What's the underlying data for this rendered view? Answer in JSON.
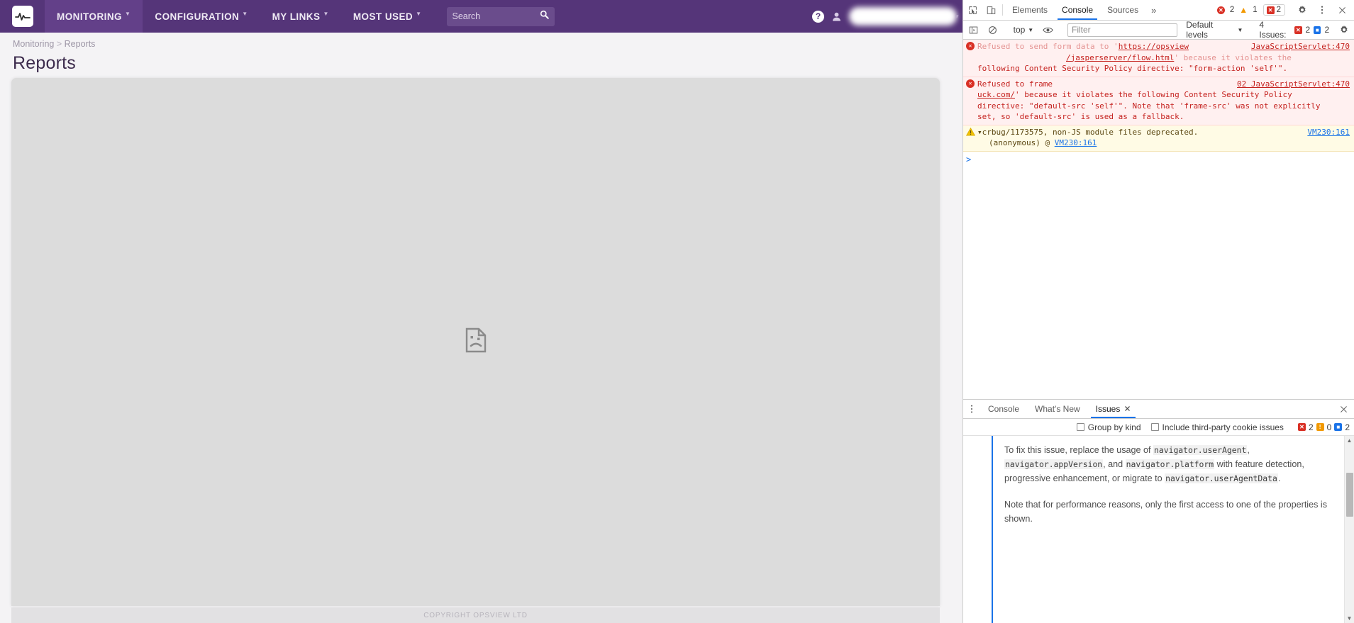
{
  "app": {
    "nav": {
      "logo_name": "opsview-logo",
      "items": [
        {
          "label": "MONITORING",
          "active": true,
          "caret": true
        },
        {
          "label": "CONFIGURATION",
          "active": false,
          "caret": true
        },
        {
          "label": "MY LINKS",
          "active": false,
          "caret": true
        },
        {
          "label": "MOST USED",
          "active": false,
          "caret": true
        }
      ],
      "search_placeholder": "Search",
      "search_value": "",
      "help_label": "?",
      "user_name_redacted": "",
      "brand_color": "#553579",
      "active_color": "#634089"
    },
    "breadcrumb": {
      "parent": "Monitoring",
      "separator": ">",
      "current": "Reports"
    },
    "page_title": "Reports",
    "content": {
      "state": "broken-frame",
      "icon_name": "sad-document-icon"
    },
    "footer": "COPYRIGHT OPSVIEW LTD"
  },
  "devtools": {
    "tabs": [
      {
        "label": "Elements",
        "active": false
      },
      {
        "label": "Console",
        "active": true
      },
      {
        "label": "Sources",
        "active": false
      }
    ],
    "more_tabs_glyph": "»",
    "counts": {
      "errors": "2",
      "warnings": "1",
      "issues": "2"
    },
    "console_toolbar": {
      "context": "top",
      "filter_placeholder": "Filter",
      "filter_value": "",
      "levels": "Default levels",
      "issues_label": "4 Issues:",
      "issues_errors": "2",
      "issues_info": "2"
    },
    "messages": [
      {
        "type": "error",
        "icon": "error-icon",
        "source": "JavaScriptServlet:470",
        "line1_pre": "Refused to send form data to '",
        "line1_url": "https://opsview",
        "line1_post": "",
        "line2_url": "/jasperserver/flow.html",
        "line2_post": "' because it violates the",
        "line3": "following Content Security Policy directive: \"form-action 'self'\"."
      },
      {
        "type": "error",
        "icon": "error-icon",
        "source": "02 JavaScriptServlet:470",
        "line1": "Refused to frame",
        "line2_url": "uck.com/",
        "line2_post": "' because it violates the following Content Security Policy",
        "line3": "directive: \"default-src 'self'\". Note that 'frame-src' was not explicitly",
        "line4": "set, so 'default-src' is used as a fallback."
      },
      {
        "type": "warning",
        "icon": "warning-icon",
        "expander": "▾",
        "text": "crbug/1173575, non-JS module files deprecated.",
        "source": "VM230:161",
        "stack_label": "(anonymous) @",
        "stack_link": "VM230:161"
      }
    ],
    "prompt_glyph": ">",
    "drawer": {
      "tabs": [
        {
          "label": "Console",
          "active": false,
          "closable": false
        },
        {
          "label": "What's New",
          "active": false,
          "closable": false
        },
        {
          "label": "Issues",
          "active": true,
          "closable": true
        }
      ],
      "toolbar": {
        "group_by_kind": "Group by kind",
        "group_by_kind_checked": false,
        "include_third_party": "Include third-party cookie issues",
        "include_third_party_checked": false,
        "count_errors": "2",
        "count_warnings": "0",
        "count_info": "2"
      },
      "issue_text": {
        "p1_a": "To fix this issue, replace the usage of ",
        "p1_c1": "navigator.userAgent",
        "p1_b": ", ",
        "p1_c2": "navigator.appVersion",
        "p1_d": ", and ",
        "p1_c3": "navigator.platform",
        "p1_e": " with feature detection, progressive enhancement, or migrate to ",
        "p1_c4": "navigator.userAgentData",
        "p1_f": ".",
        "p2": "Note that for performance reasons, only the first access to one of the properties is shown."
      }
    }
  }
}
